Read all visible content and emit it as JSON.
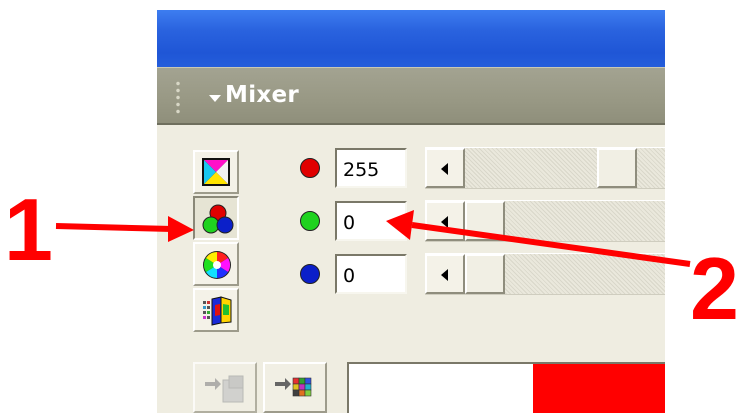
{
  "panel": {
    "title": "Mixer"
  },
  "color_modes": [
    {
      "name": "cmyk-mode",
      "icon": "cmy-triangle-icon",
      "selected": false
    },
    {
      "name": "rgb-mode",
      "icon": "rgb-circles-icon",
      "selected": true
    },
    {
      "name": "hsb-mode",
      "icon": "color-wheel-icon",
      "selected": false
    },
    {
      "name": "swatch-mode",
      "icon": "color-grid-icon",
      "selected": false
    }
  ],
  "channels": [
    {
      "name": "red",
      "color": "#e00000",
      "value": "255",
      "level": 1.0
    },
    {
      "name": "green",
      "color": "#1fd21f",
      "value": "0",
      "level": 0.0
    },
    {
      "name": "blue",
      "color": "#0b1fc9",
      "value": "0",
      "level": 0.0
    }
  ],
  "bottom_buttons": [
    {
      "name": "add-to-swatches",
      "icon": "arrow-swatch-icon"
    },
    {
      "name": "swatch-grid",
      "icon": "arrow-grid-icon"
    }
  ],
  "color_preview": {
    "previous": "#ffffff",
    "current": "#ff0000"
  },
  "annotations": {
    "label_1": "1",
    "label_2": "2",
    "color": "#ff0000"
  }
}
